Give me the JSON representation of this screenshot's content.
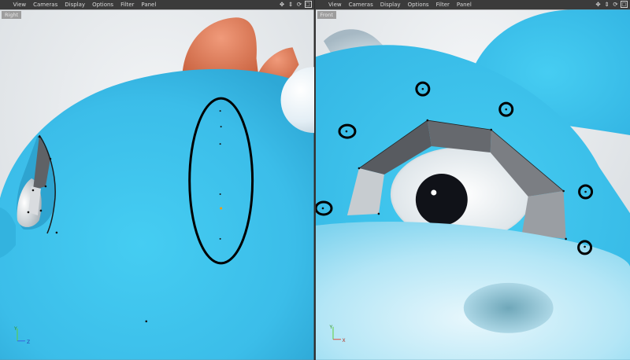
{
  "menus": [
    "View",
    "Cameras",
    "Display",
    "Options",
    "Filter",
    "Panel"
  ],
  "left_viewport": {
    "label": "Right",
    "axis": {
      "y": "Y",
      "z": "Z"
    }
  },
  "right_viewport": {
    "label": "Front",
    "axis": {
      "y": "Y",
      "x": "X"
    }
  },
  "nav_icons": [
    "move-icon",
    "zoom-icon",
    "rotate-icon",
    "maximize-icon"
  ],
  "colors": {
    "body_blue": "#3cc3ec",
    "horn": "#e07a5a",
    "menubar": "#3b3b3b",
    "annotation": "#000000"
  }
}
